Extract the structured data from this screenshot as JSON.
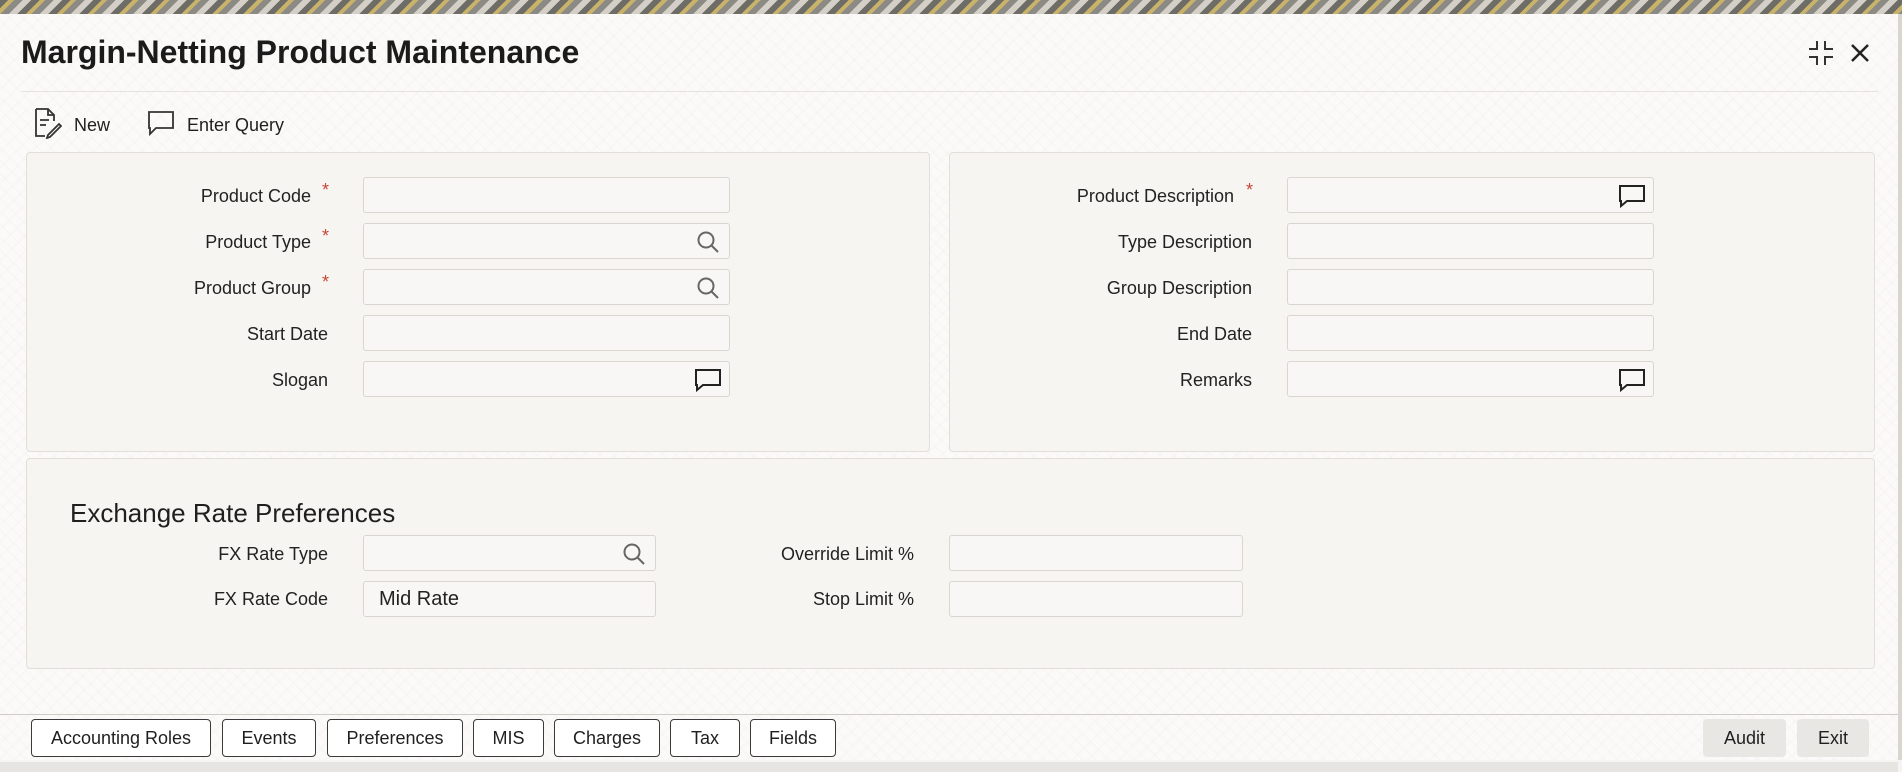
{
  "window": {
    "title": "Margin-Netting Product Maintenance"
  },
  "toolbar": {
    "new_label": "New",
    "enter_query_label": "Enter Query"
  },
  "main_left": {
    "product_code": {
      "label": "Product Code",
      "required": "*",
      "value": ""
    },
    "product_type": {
      "label": "Product Type",
      "required": "*",
      "value": ""
    },
    "product_group": {
      "label": "Product Group",
      "required": "*",
      "value": ""
    },
    "start_date": {
      "label": "Start Date",
      "value": ""
    },
    "slogan": {
      "label": "Slogan",
      "value": ""
    }
  },
  "main_right": {
    "product_description": {
      "label": "Product Description",
      "required": "*",
      "value": ""
    },
    "type_description": {
      "label": "Type Description",
      "value": ""
    },
    "group_description": {
      "label": "Group Description",
      "value": ""
    },
    "end_date": {
      "label": "End Date",
      "value": ""
    },
    "remarks": {
      "label": "Remarks",
      "value": ""
    }
  },
  "exchange_rate": {
    "title": "Exchange Rate Preferences",
    "fx_rate_type": {
      "label": "FX Rate Type",
      "value": ""
    },
    "fx_rate_code": {
      "label": "FX Rate Code",
      "value": "Mid Rate"
    },
    "override_limit": {
      "label": "Override Limit %",
      "value": ""
    },
    "stop_limit": {
      "label": "Stop Limit %",
      "value": ""
    }
  },
  "footer": {
    "buttons": [
      "Accounting Roles",
      "Events",
      "Preferences",
      "MIS",
      "Charges",
      "Tax",
      "Fields"
    ],
    "audit_label": "Audit",
    "exit_label": "Exit"
  },
  "icons": [
    "document-edit-icon",
    "comment-icon",
    "search-icon",
    "maximize-icon",
    "close-icon"
  ],
  "colors": {
    "required": "#c74634",
    "panel_bg": "#f7f5f2",
    "border": "#d9d6d0"
  }
}
